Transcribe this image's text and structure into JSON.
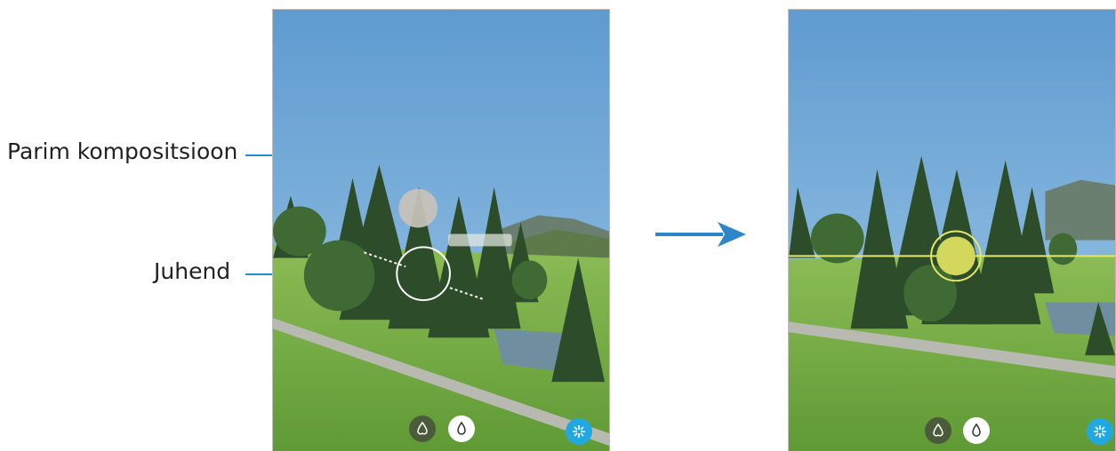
{
  "labels": {
    "best_composition": "Parim kompositsioon",
    "guide": "Juhend"
  },
  "icons": {
    "bokeh_icon": "bokeh-icon",
    "drop_icon": "drop-icon",
    "shutter_icon": "aperture-icon",
    "arrow_icon": "arrow-right-icon"
  },
  "colors": {
    "sky": "#6aa6d6",
    "grass": "#7fb04a",
    "shutter": "#22a8e0",
    "guide_line": "#e3e86b",
    "arrow": "#2e86c8"
  }
}
